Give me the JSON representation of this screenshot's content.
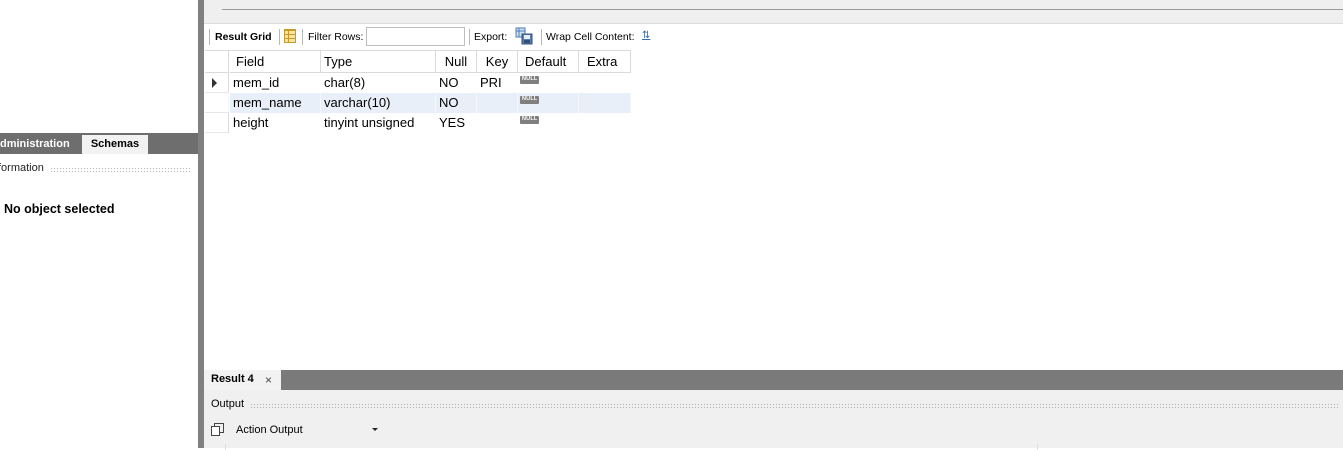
{
  "left_panel": {
    "tabs": [
      "Administration",
      "Schemas"
    ],
    "active_tab": "Schemas",
    "info_header": "Information",
    "info_header_visible": "formation",
    "admin_visible": "dministration",
    "empty_message": "No object selected"
  },
  "toolbar": {
    "result_grid": "Result Grid",
    "filter_rows": "Filter Rows:",
    "filter_value": "",
    "export": "Export:",
    "wrap_cell_content": "Wrap Cell Content:",
    "wrap_icon": "wrap-text-icon",
    "grid_icon": "result-grid-icon",
    "export_icon": "export-icon"
  },
  "grid": {
    "columns": [
      "Field",
      "Type",
      "Null",
      "Key",
      "Default",
      "Extra"
    ],
    "rows": [
      {
        "field": "mem_id",
        "type": "char(8)",
        "null": "NO",
        "key": "PRI",
        "default": "NULL",
        "extra": ""
      },
      {
        "field": "mem_name",
        "type": "varchar(10)",
        "null": "NO",
        "key": "",
        "default": "NULL",
        "extra": ""
      },
      {
        "field": "height",
        "type": "tinyint unsigned",
        "null": "YES",
        "key": "",
        "default": "NULL",
        "extra": ""
      }
    ],
    "selected_row": 0
  },
  "result_tab": {
    "label": "Result 4",
    "close": "×"
  },
  "output": {
    "label": "Output",
    "selector": "Action Output"
  },
  "colors": {
    "tab_bar": "#6e6e6e",
    "splitter": "#808080",
    "alt_row": "#e8eff9",
    "null_badge": "#7f7f7f"
  }
}
